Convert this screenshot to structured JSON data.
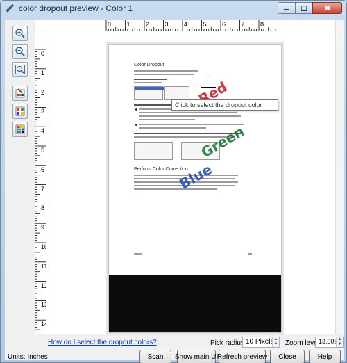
{
  "window": {
    "title": "color dropout preview - Color 1",
    "controls": [
      "minimize",
      "maximize",
      "close"
    ]
  },
  "toolbar": {
    "tools": [
      {
        "name": "zoom-in-icon"
      },
      {
        "name": "zoom-out-icon"
      },
      {
        "name": "fit-page-icon"
      },
      {
        "name": "color-picker-icon"
      },
      {
        "name": "color-palette-icon"
      },
      {
        "name": "color-grid-icon"
      }
    ]
  },
  "ruler": {
    "horizontal_labels": [
      "0",
      "1",
      "2",
      "3",
      "4",
      "5",
      "6",
      "7",
      "8"
    ],
    "vertical_labels": [
      "0",
      "1",
      "2",
      "3",
      "4",
      "5",
      "6",
      "7",
      "8",
      "9",
      "10",
      "11",
      "12",
      "13",
      "14"
    ]
  },
  "preview": {
    "document_heading": "Color Dropout",
    "section_heading": "Perform Color Correction",
    "overlay_words": [
      {
        "text": "Red",
        "color": "#c0282d"
      },
      {
        "text": "Green",
        "color": "#1f7a3a"
      },
      {
        "text": "Blue",
        "color": "#2e4fb0"
      }
    ],
    "tooltip": "Click to select the dropout color"
  },
  "footer": {
    "help_link": "How do I select the dropout colors?",
    "pick_radius_label": "Pick radius:",
    "pick_radius_value": "10 Pixels",
    "zoom_label": "Zoom level:",
    "zoom_value": "13.00%",
    "units_label": "Units: Inches",
    "buttons": {
      "scan": "Scan",
      "show_main_ui": "Show main UI",
      "refresh": "Refresh preview",
      "close": "Close",
      "help": "Help"
    }
  }
}
